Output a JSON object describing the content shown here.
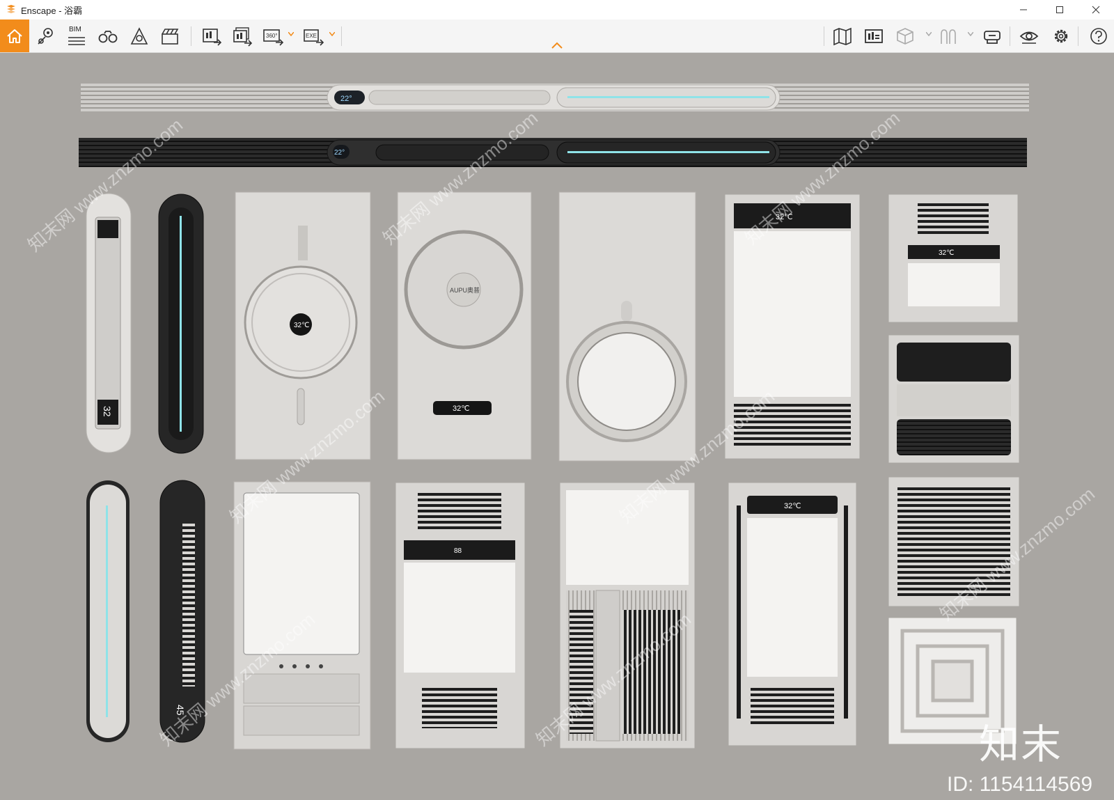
{
  "window": {
    "title": "Enscape - 浴霸",
    "minimize_icon": "minimize-icon",
    "maximize_icon": "maximize-icon",
    "close_icon": "close-icon"
  },
  "toolbar": {
    "home_icon": "home-icon",
    "bim_label": "BIM",
    "badge_360": "360°",
    "badge_exe": "EXE",
    "collapse_icon": "chevron-up-icon",
    "accent_color": "#f28c1b"
  },
  "viewport": {
    "description_colors": {
      "background": "#a9a6a2"
    },
    "temp_labels": [
      "22°",
      "22°",
      "32℃",
      "32℃",
      "32℃",
      "32℃",
      "32℃",
      "45"
    ],
    "brand_text": "AUPU奥普",
    "watermark_logo": "知末",
    "watermark_id": "ID: 1154114569",
    "diagonal_watermark": "知末网 www.znzmo.com"
  }
}
